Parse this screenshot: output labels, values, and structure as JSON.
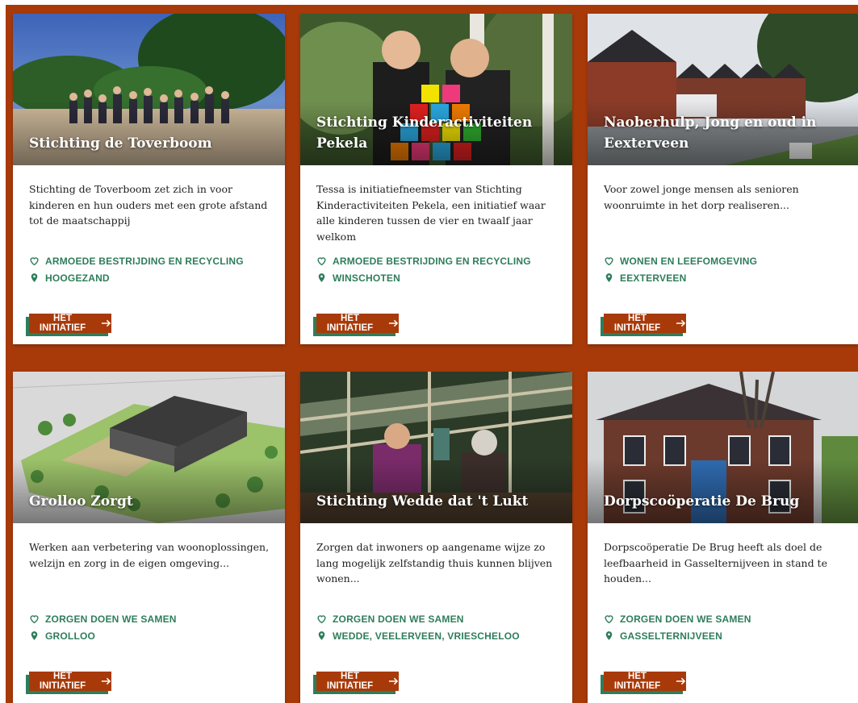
{
  "cards": [
    {
      "title": "Stichting de Toverboom",
      "description": "Stichting de Toverboom zet zich in voor kinderen en hun ouders met een grote afstand tot de maatschappij",
      "theme": "ARMOEDE BESTRIJDING EN RECYCLING",
      "location": "HOOGEZAND",
      "button": "HET INITIATIEF",
      "photo": "group-photo-beach"
    },
    {
      "title": "Stichting Kinderactiviteiten Pekela",
      "description": "Tessa is initiatiefneemster van Stichting Kinderactiviteiten Pekela, een initiatief waar alle kinderen tussen de vier en twaalf jaar welkom",
      "theme": "ARMOEDE BESTRIJDING EN RECYCLING",
      "location": "WINSCHOTEN",
      "button": "HET INITIATIEF",
      "photo": "kids-cup-tower"
    },
    {
      "title": "Naoberhulp, Jong en oud in Eexterveen",
      "description": "Voor zowel jonge mensen als senioren woonruimte in het dorp realiseren...",
      "theme": "WONEN EN LEEFOMGEVING",
      "location": "EEXTERVEEN",
      "button": "HET INITIATIEF",
      "photo": "village-houses"
    },
    {
      "title": "Grolloo Zorgt",
      "description": "Werken aan verbetering van woonoplossingen, welzijn en zorg in de eigen omgeving...",
      "theme": "ZORGEN DOEN WE SAMEN",
      "location": "GROLLOO",
      "button": "HET INITIATIEF",
      "photo": "architectural-model"
    },
    {
      "title": "Stichting Wedde dat 't Lukt",
      "description": "Zorgen dat inwoners op aangename wijze zo lang mogelijk zelfstandig thuis kunnen blijven wonen...",
      "theme": "ZORGEN DOEN WE SAMEN",
      "location": "WEDDE, VEELERVEEN, VRIESCHELOO",
      "button": "HET INITIATIEF",
      "photo": "greenhouse-workers"
    },
    {
      "title": "Dorpscoöperatie De Brug",
      "description": "Dorpscoöperatie De Brug heeft als doel de leefbaarheid in Gasselternijveen in stand te houden...",
      "theme": "ZORGEN DOEN WE SAMEN",
      "location": "GASSELTERNIJVEEN",
      "button": "HET INITIATIEF",
      "photo": "brick-building"
    }
  ],
  "colors": {
    "background": "#a83a0a",
    "accent_green": "#2e7d5a",
    "button": "#a83a0a"
  }
}
